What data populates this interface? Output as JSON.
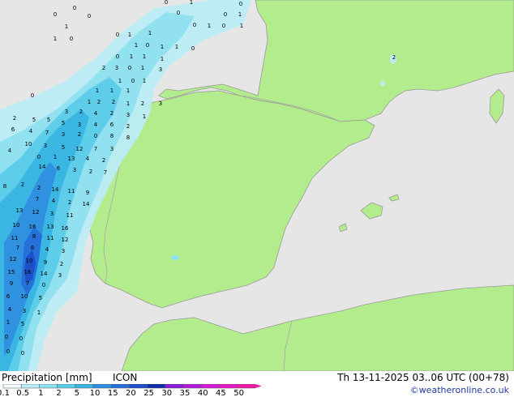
{
  "footer": {
    "title": "Precipitation [mm]",
    "model": "ICON",
    "valid": "Th 13-11-2025 03..06 UTC (00+78)",
    "credit": "©weatheronline.co.uk"
  },
  "legend": {
    "labels": [
      "0.1",
      "0.5",
      "1",
      "2",
      "5",
      "10",
      "15",
      "20",
      "25",
      "30",
      "35",
      "40",
      "45",
      "50"
    ],
    "colors": [
      "#f2fbfd",
      "#bcecf5",
      "#8fe0f0",
      "#5ccbe8",
      "#38b4e3",
      "#2f8fe0",
      "#256fd8",
      "#1b4ec8",
      "#0f2fa8",
      "#8a1bd8",
      "#b01bd8",
      "#d21bd8",
      "#e61bc8",
      "#f01ba8"
    ]
  },
  "colors": {
    "sea": "#e6e6e6",
    "land": "#b3ec8c",
    "coast": "#9a9a9a",
    "border": "#a8a8a8"
  },
  "map_values": [
    "0",
    "0",
    "0",
    "1",
    "0",
    "0",
    "1",
    "0",
    "0",
    "1",
    "0",
    "1",
    "0",
    "1",
    "1",
    "0",
    "0",
    "1",
    "1",
    "1",
    "0",
    "1",
    "1",
    "0",
    "0",
    "1",
    "1",
    "1",
    "2",
    "3",
    "0",
    "1",
    "3",
    "1",
    "0",
    "1",
    "1",
    "1",
    "1",
    "0",
    "1",
    "2",
    "2",
    "1",
    "2",
    "3",
    "3",
    "2",
    "4",
    "2",
    "3",
    "1",
    "2",
    "5",
    "5",
    "5",
    "3",
    "4",
    "6",
    "2",
    "6",
    "4",
    "7",
    "3",
    "2",
    "0",
    "8",
    "8",
    "4",
    "10",
    "3",
    "5",
    "12",
    "7",
    "3",
    "0",
    "1",
    "13",
    "4",
    "2",
    "14",
    "6",
    "3",
    "2",
    "7",
    "8",
    "2",
    "2",
    "14",
    "11",
    "9",
    "7",
    "4",
    "2",
    "14",
    "13",
    "12",
    "3",
    "11",
    "10",
    "16",
    "13",
    "16",
    "11",
    "8",
    "11",
    "12",
    "7",
    "8",
    "4",
    "3",
    "12",
    "10",
    "9",
    "2",
    "15",
    "16",
    "14",
    "3",
    "9",
    "7",
    "0",
    "6",
    "10",
    "5",
    "4",
    "3",
    "1",
    "1",
    "5",
    "0",
    "0",
    "0",
    "0",
    "2"
  ]
}
